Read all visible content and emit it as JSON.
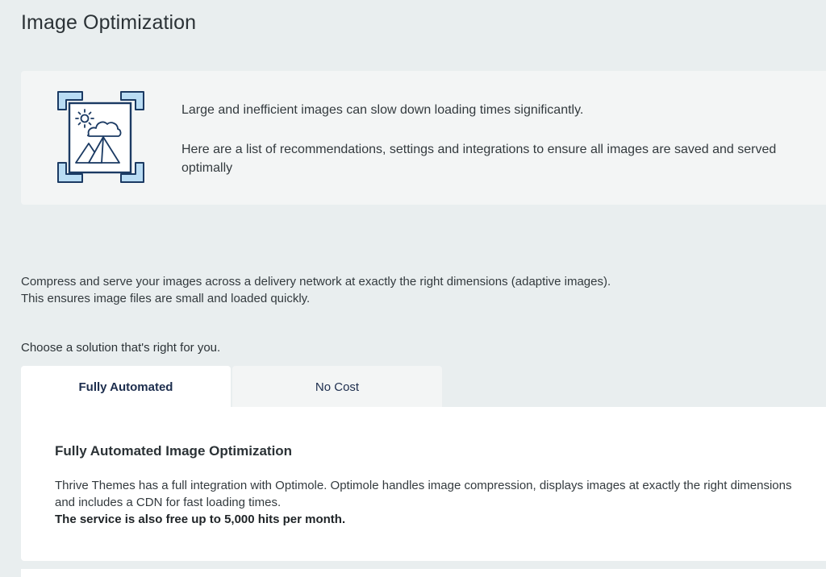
{
  "page": {
    "title": "Image Optimization"
  },
  "intro": {
    "icon": "image-frame-icon",
    "line1": "Large and inefficient images can slow down loading times significantly.",
    "line2": "Here are a list of recommendations, settings and integrations to ensure all images are saved and served optimally"
  },
  "description": {
    "line1": "Compress and serve your images across a delivery network at exactly the right dimensions (adaptive images).",
    "line2": "This ensures image files are small and loaded quickly."
  },
  "solutions": {
    "prompt": "Choose a solution that's right for you.",
    "tabs": [
      {
        "label": "Fully Automated",
        "active": true
      },
      {
        "label": "No Cost",
        "active": false
      }
    ]
  },
  "panel": {
    "title": "Fully Automated Image Optimization",
    "body": "Thrive Themes has a full integration with Optimole. Optimole handles image compression, displays images at exactly the right dimensions and includes a CDN for fast loading times.",
    "highlight": "The service is also free up to 5,000 hits per month."
  },
  "colors": {
    "background": "#e9eeef",
    "card": "#f3f5f5",
    "panel": "#ffffff",
    "icon_stroke": "#1b3a63",
    "icon_fill": "#b9dcf4",
    "tab_text": "#1c2d4d"
  }
}
